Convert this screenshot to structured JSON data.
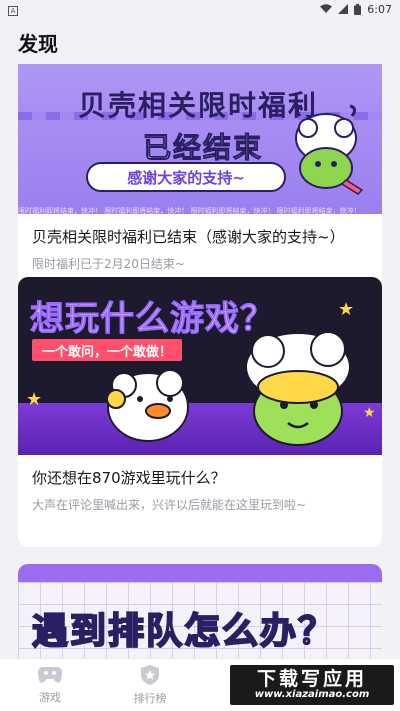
{
  "status_bar": {
    "app_icon": "A",
    "time": "6:07"
  },
  "header": {
    "title": "发现"
  },
  "cards": [
    {
      "banner": {
        "headline_1": "贝壳相关限时福利",
        "headline_2": "已经结束",
        "pill": "感谢大家的支持~",
        "ticker": "限时福利即将结束，快冲！   限时福利即将结束，快冲！   限时福利即将结束，快冲！   限时福利即将结束，快冲！"
      },
      "title": "贝壳相关限时福利已结束（感谢大家的支持~）",
      "subtitle": "限时福利已于2月20日结束~"
    },
    {
      "banner": {
        "headline": "想玩什么游戏？",
        "pill": "一个敢问，一个敢做！"
      },
      "title": "你还想在870游戏里玩什么？",
      "subtitle": "大声在评论里喊出来，兴许以后就能在这里玩到啦~"
    },
    {
      "banner": {
        "headline": "遇到排队怎么办？"
      }
    }
  ],
  "tabbar": [
    {
      "label": "游戏",
      "icon": "gamepad-icon"
    },
    {
      "label": "排行榜",
      "icon": "ranking-shield-icon"
    }
  ],
  "watermark": {
    "brand": "下载写应用",
    "url": "www.xiazaimao.com"
  }
}
